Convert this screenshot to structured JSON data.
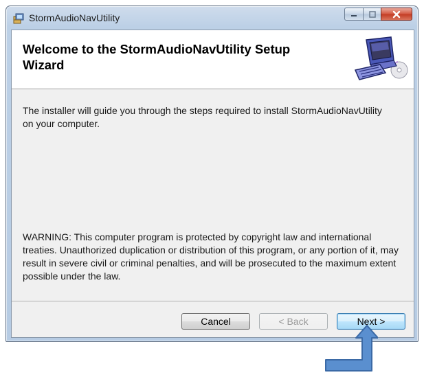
{
  "window": {
    "title": "StormAudioNavUtility"
  },
  "header": {
    "title": "Welcome to the StormAudioNavUtility Setup Wizard"
  },
  "body": {
    "intro": "The installer will guide you through the steps required to install StormAudioNavUtility on your computer.",
    "warning": "WARNING: This computer program is protected by copyright law and international treaties. Unauthorized duplication or distribution of this program, or any portion of it, may result in severe civil or criminal penalties, and will be prosecuted to the maximum extent possible under the law."
  },
  "buttons": {
    "cancel": "Cancel",
    "back": "< Back",
    "next": "Next >",
    "back_enabled": false
  },
  "icons": {
    "app": "installer-package-icon",
    "header_logo": "computer-with-cd-icon",
    "annotation": "arrow-pointing-up-icon"
  },
  "colors": {
    "annotation_arrow": "#5a8fcf"
  }
}
